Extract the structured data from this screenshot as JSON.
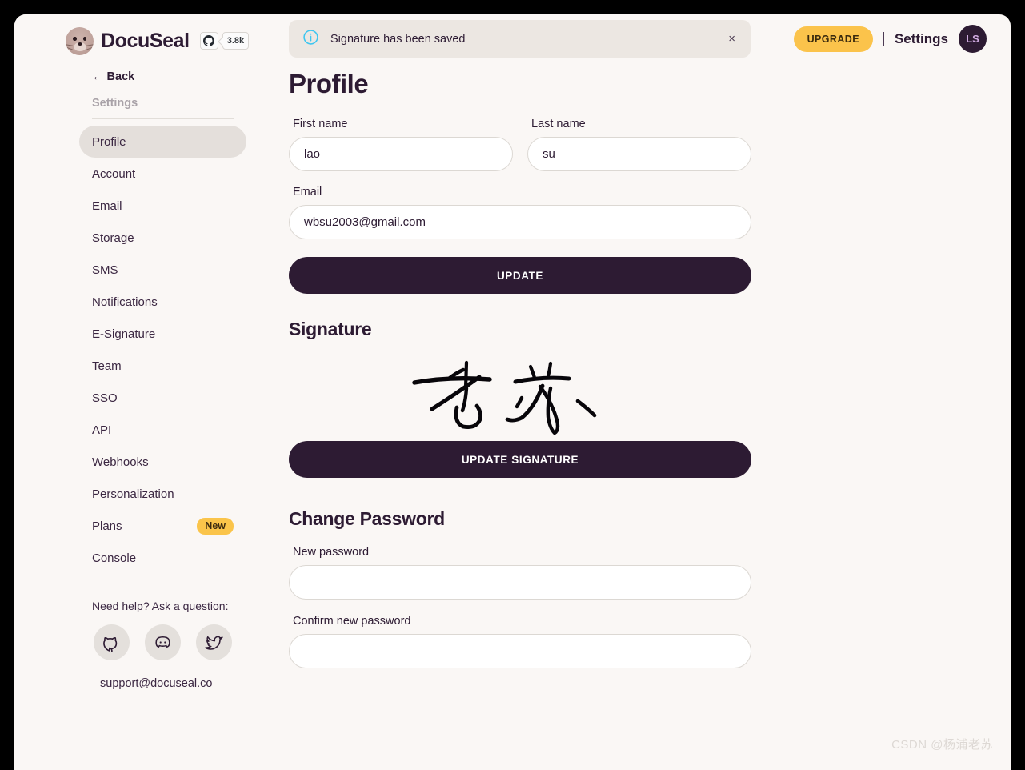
{
  "brand": {
    "name": "DocuSeal",
    "logo_icon": "seal-face-icon",
    "github_icon": "github-icon",
    "github_stars": "3.8k"
  },
  "sidebar": {
    "back_label": "← Back",
    "section_label": "Settings",
    "items": [
      {
        "label": "Profile",
        "active": true
      },
      {
        "label": "Account",
        "active": false
      },
      {
        "label": "Email",
        "active": false
      },
      {
        "label": "Storage",
        "active": false
      },
      {
        "label": "SMS",
        "active": false
      },
      {
        "label": "Notifications",
        "active": false
      },
      {
        "label": "E-Signature",
        "active": false
      },
      {
        "label": "Team",
        "active": false
      },
      {
        "label": "SSO",
        "active": false
      },
      {
        "label": "API",
        "active": false
      },
      {
        "label": "Webhooks",
        "active": false
      },
      {
        "label": "Personalization",
        "active": false
      },
      {
        "label": "Plans",
        "active": false,
        "badge": "New"
      },
      {
        "label": "Console",
        "active": false
      }
    ],
    "help": {
      "prompt": "Need help? Ask a question:",
      "socials": [
        {
          "icon": "github-icon",
          "name": "github"
        },
        {
          "icon": "discord-icon",
          "name": "discord"
        },
        {
          "icon": "twitter-icon",
          "name": "twitter"
        }
      ],
      "support_email": "support@docuseal.co"
    }
  },
  "alert": {
    "icon": "info-circle-icon",
    "message": "Signature has been saved",
    "close_label": "×",
    "bg_color": "#ece7e2",
    "icon_color": "#3ec6f0"
  },
  "header": {
    "upgrade_label": "UPGRADE",
    "settings_label": "Settings",
    "avatar_initials": "LS",
    "upgrade_color": "#fbc34b",
    "avatar_bg": "#2d1b33"
  },
  "main": {
    "page_title": "Profile",
    "profile_form": {
      "first_name": {
        "label": "First name",
        "value": "lao",
        "placeholder": ""
      },
      "last_name": {
        "label": "Last name",
        "value": "su",
        "placeholder": ""
      },
      "email": {
        "label": "Email",
        "value": "wbsu2003@gmail.com",
        "placeholder": ""
      },
      "submit_label": "UPDATE"
    },
    "signature": {
      "title": "Signature",
      "image_alt": "老苏",
      "submit_label": "UPDATE SIGNATURE"
    },
    "password_form": {
      "title": "Change Password",
      "new_password": {
        "label": "New password",
        "value": "",
        "placeholder": ""
      },
      "confirm_password": {
        "label": "Confirm new password",
        "value": "",
        "placeholder": ""
      }
    }
  },
  "watermark": "CSDN @杨浦老苏",
  "theme": {
    "page_bg": "#faf7f5",
    "accent_dark": "#2d1b33",
    "active_pill": "#e4dfdb"
  }
}
